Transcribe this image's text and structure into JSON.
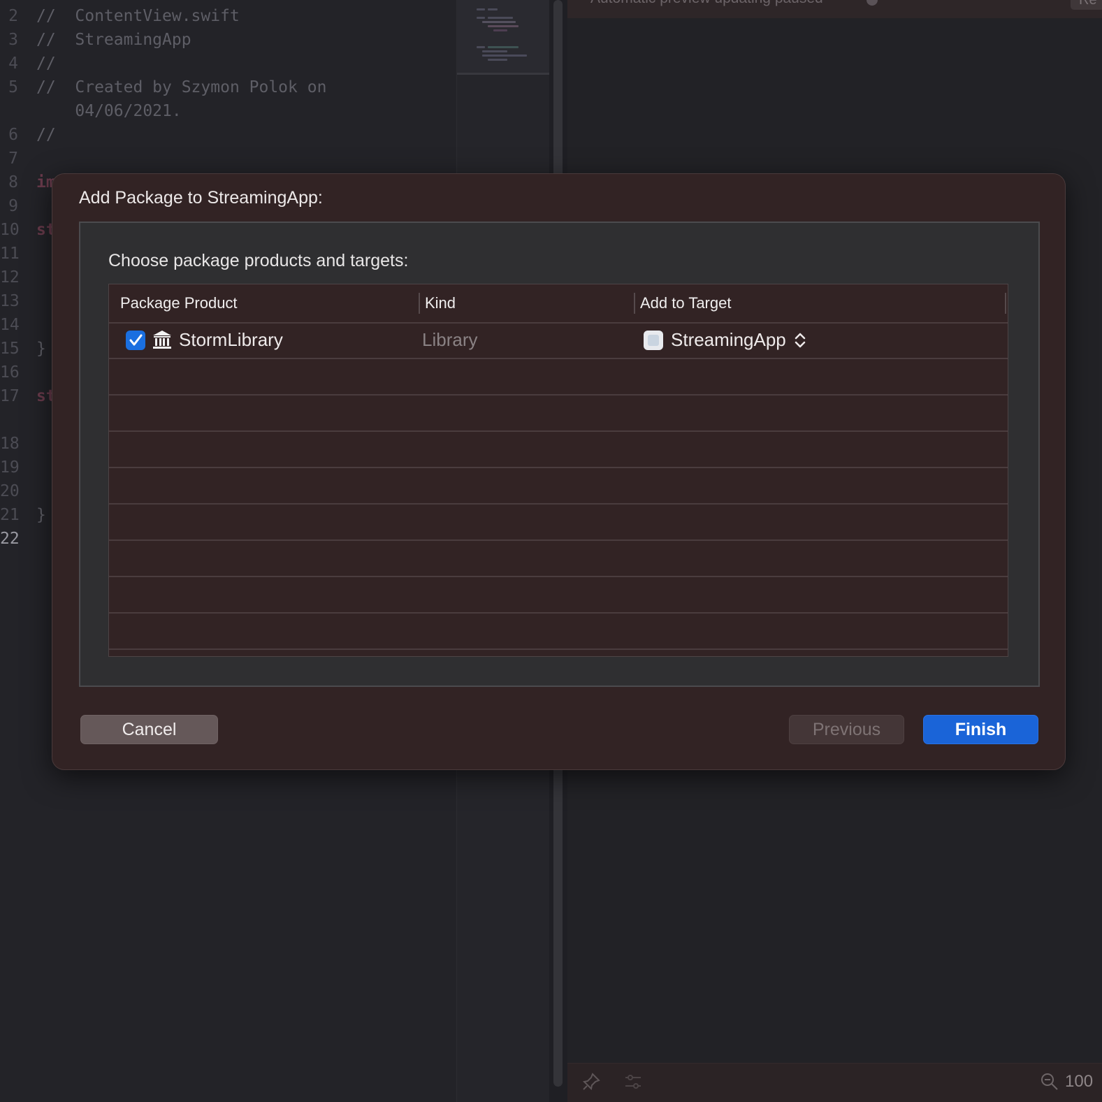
{
  "editor": {
    "lines": [
      {
        "num": "2",
        "text": "//  ContentView.swift",
        "kind": "comment"
      },
      {
        "num": "3",
        "text": "//  StreamingApp",
        "kind": "comment"
      },
      {
        "num": "4",
        "text": "//",
        "kind": "comment"
      },
      {
        "num": "5",
        "text": "//  Created by Szymon Polok on",
        "kind": "comment"
      },
      {
        "num": "",
        "text": "    04/06/2021.",
        "kind": "comment"
      },
      {
        "num": "6",
        "text": "//",
        "kind": "comment"
      },
      {
        "num": "7",
        "text": "",
        "kind": "plain"
      },
      {
        "num": "8",
        "text": "im",
        "kind": "keyword"
      },
      {
        "num": "9",
        "text": "",
        "kind": "plain"
      },
      {
        "num": "10",
        "text": "st",
        "kind": "keyword"
      },
      {
        "num": "11",
        "text": "",
        "kind": "plain"
      },
      {
        "num": "12",
        "text": "",
        "kind": "plain"
      },
      {
        "num": "13",
        "text": "",
        "kind": "plain"
      },
      {
        "num": "14",
        "text": "",
        "kind": "plain"
      },
      {
        "num": "15",
        "text": "}",
        "kind": "plain"
      },
      {
        "num": "16",
        "text": "",
        "kind": "plain"
      },
      {
        "num": "17",
        "text": "st",
        "kind": "keyword"
      },
      {
        "num": "",
        "text": "",
        "kind": "plain"
      },
      {
        "num": "18",
        "text": "",
        "kind": "plain"
      },
      {
        "num": "19",
        "text": "",
        "kind": "plain"
      },
      {
        "num": "20",
        "text": "",
        "kind": "plain"
      },
      {
        "num": "21",
        "text": "}",
        "kind": "plain"
      },
      {
        "num": "22",
        "text": "",
        "kind": "plain",
        "current": true
      }
    ]
  },
  "canvas": {
    "status_message": "Automatic preview updating paused",
    "resume_label": "Re",
    "zoom_level": "100"
  },
  "dialog": {
    "title": "Add Package to StreamingApp:",
    "subtitle": "Choose package products and targets:",
    "columns": {
      "product": "Package Product",
      "kind": "Kind",
      "target": "Add to Target"
    },
    "rows": [
      {
        "checked": true,
        "product": "StormLibrary",
        "product_icon": "library-building-icon",
        "kind": "Library",
        "target": "StreamingApp",
        "target_icon": "app-target-icon"
      }
    ],
    "buttons": {
      "cancel": "Cancel",
      "previous": "Previous",
      "finish": "Finish"
    }
  },
  "colors": {
    "accent": "#1a64d8",
    "sheet_background": "#322324",
    "keyword": "#6a3b4c"
  }
}
